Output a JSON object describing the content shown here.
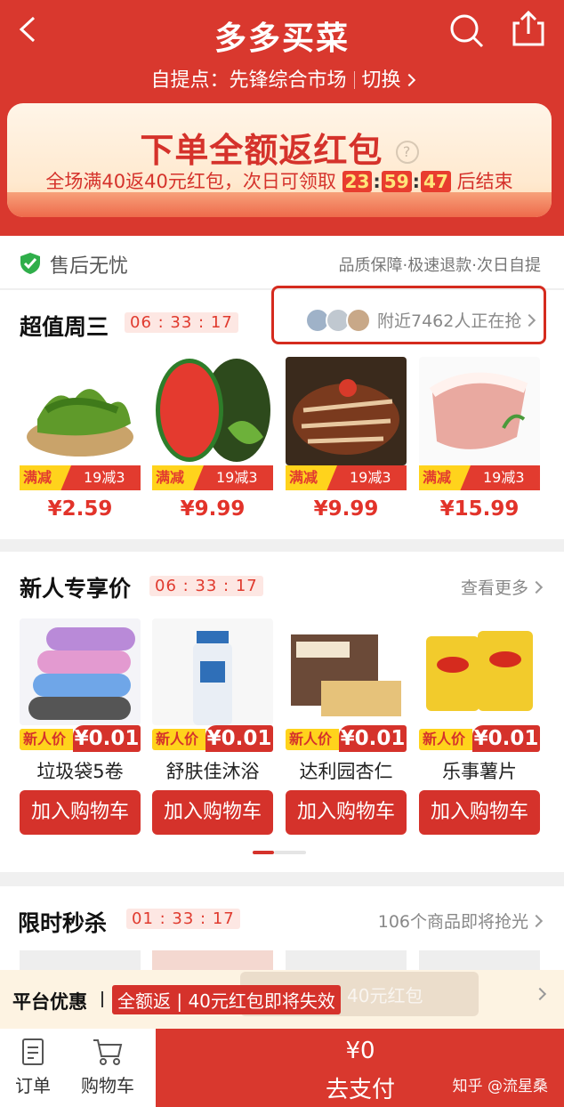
{
  "header": {
    "title": "多多买菜",
    "pickup_label": "自提点：先锋综合市场",
    "switch_label": "切换"
  },
  "banner": {
    "headline": "下单全额返红包",
    "question_mark": "?",
    "sub_prefix": "全场满40返40元红包，次日可领取",
    "hh": "23",
    "mm": "59",
    "ss": "47",
    "sub_suffix": "后结束"
  },
  "guarantee": {
    "label": "售后无忧",
    "features": "品质保障·极速退款·次日自提"
  },
  "section_deal": {
    "title": "超值周三",
    "timer": "06 : 33 : 17",
    "nearby": "附近7462人正在抢",
    "products": [
      {
        "tag_a": "满减",
        "tag_b": "19减3",
        "price": "¥2.59"
      },
      {
        "tag_a": "满减",
        "tag_b": "19减3",
        "price": "¥9.99"
      },
      {
        "tag_a": "满减",
        "tag_b": "19减3",
        "price": "¥9.99"
      },
      {
        "tag_a": "满减",
        "tag_b": "19减3",
        "price": "¥15.99"
      }
    ]
  },
  "section_new": {
    "title": "新人专享价",
    "timer": "06 : 33 : 17",
    "more": "查看更多",
    "products": [
      {
        "tag": "新人价",
        "price": "¥0.01",
        "name": "垃圾袋5卷",
        "button": "加入购物车"
      },
      {
        "tag": "新人价",
        "price": "¥0.01",
        "name": "舒肤佳沐浴",
        "button": "加入购物车"
      },
      {
        "tag": "新人价",
        "price": "¥0.01",
        "name": "达利园杏仁",
        "button": "加入购物车"
      },
      {
        "tag": "新人价",
        "price": "¥0.01",
        "name": "乐事薯片",
        "button": "加入购物车"
      }
    ]
  },
  "section_flash": {
    "title": "限时秒杀",
    "timer": "01 : 33 : 17",
    "more": "106个商品即将抢光"
  },
  "platform": {
    "label": "平台优惠",
    "tag_a": "全额返",
    "tag_b": "40元红包即将失效",
    "ghost": "40元红包"
  },
  "bottom": {
    "orders": "订单",
    "cart": "购物车",
    "amount": "¥0",
    "pay": "去支付"
  },
  "watermark": "知乎 @流星桑",
  "colors": {
    "brand_red": "#d9382e",
    "yellow": "#ffd31c"
  }
}
